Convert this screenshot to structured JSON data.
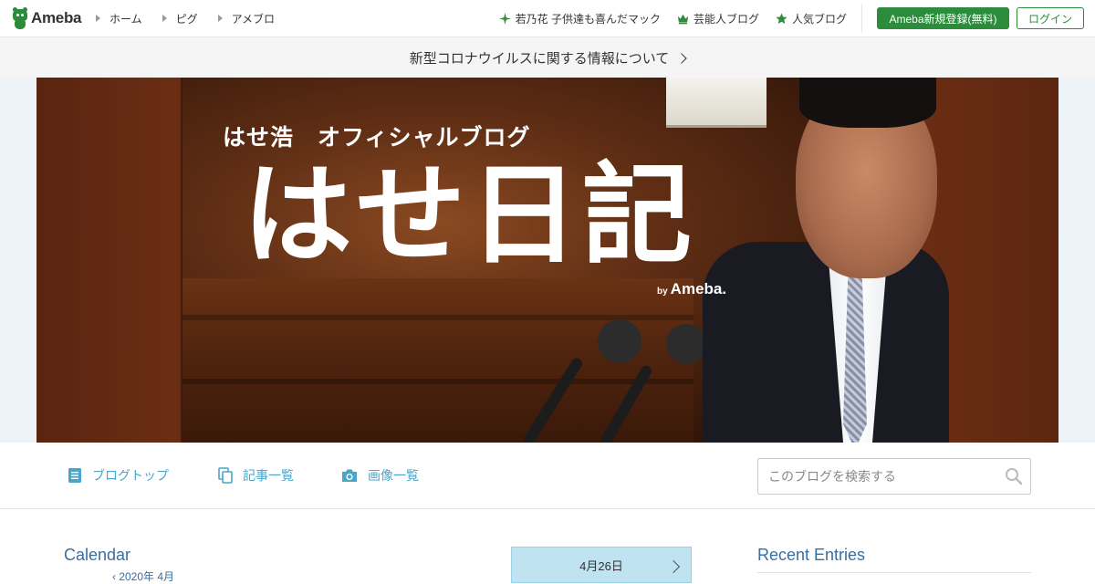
{
  "header": {
    "logo_text": "Ameba",
    "nav_left": [
      {
        "label": "ホーム"
      },
      {
        "label": "ピグ"
      },
      {
        "label": "アメブロ"
      }
    ],
    "nav_right": [
      {
        "label": "若乃花 子供達も喜んだマック",
        "icon": "sparkle-icon"
      },
      {
        "label": "芸能人ブログ",
        "icon": "crown-icon"
      },
      {
        "label": "人気ブログ",
        "icon": "star-icon"
      }
    ],
    "register_label": "Ameba新規登録(無料)",
    "login_label": "ログイン"
  },
  "notice": {
    "text": "新型コロナウイルスに関する情報について"
  },
  "banner": {
    "subtitle": "はせ浩　オフィシャルブログ",
    "title": "はせ日記",
    "by": "by",
    "brand": "Ameba."
  },
  "blognav": {
    "links": [
      {
        "label": "ブログトップ",
        "icon": "document-icon"
      },
      {
        "label": "記事一覧",
        "icon": "copy-icon"
      },
      {
        "label": "画像一覧",
        "icon": "camera-icon"
      }
    ],
    "search_placeholder": "このブログを検索する"
  },
  "content": {
    "calendar_title": "Calendar",
    "calendar_month": "‹  2020年 4月",
    "date_label": "4月26日",
    "recent_title": "Recent Entries"
  },
  "colors": {
    "brand_green": "#2d8c3c",
    "link_blue": "#4aa5c8",
    "heading_blue": "#3a6ea0"
  }
}
